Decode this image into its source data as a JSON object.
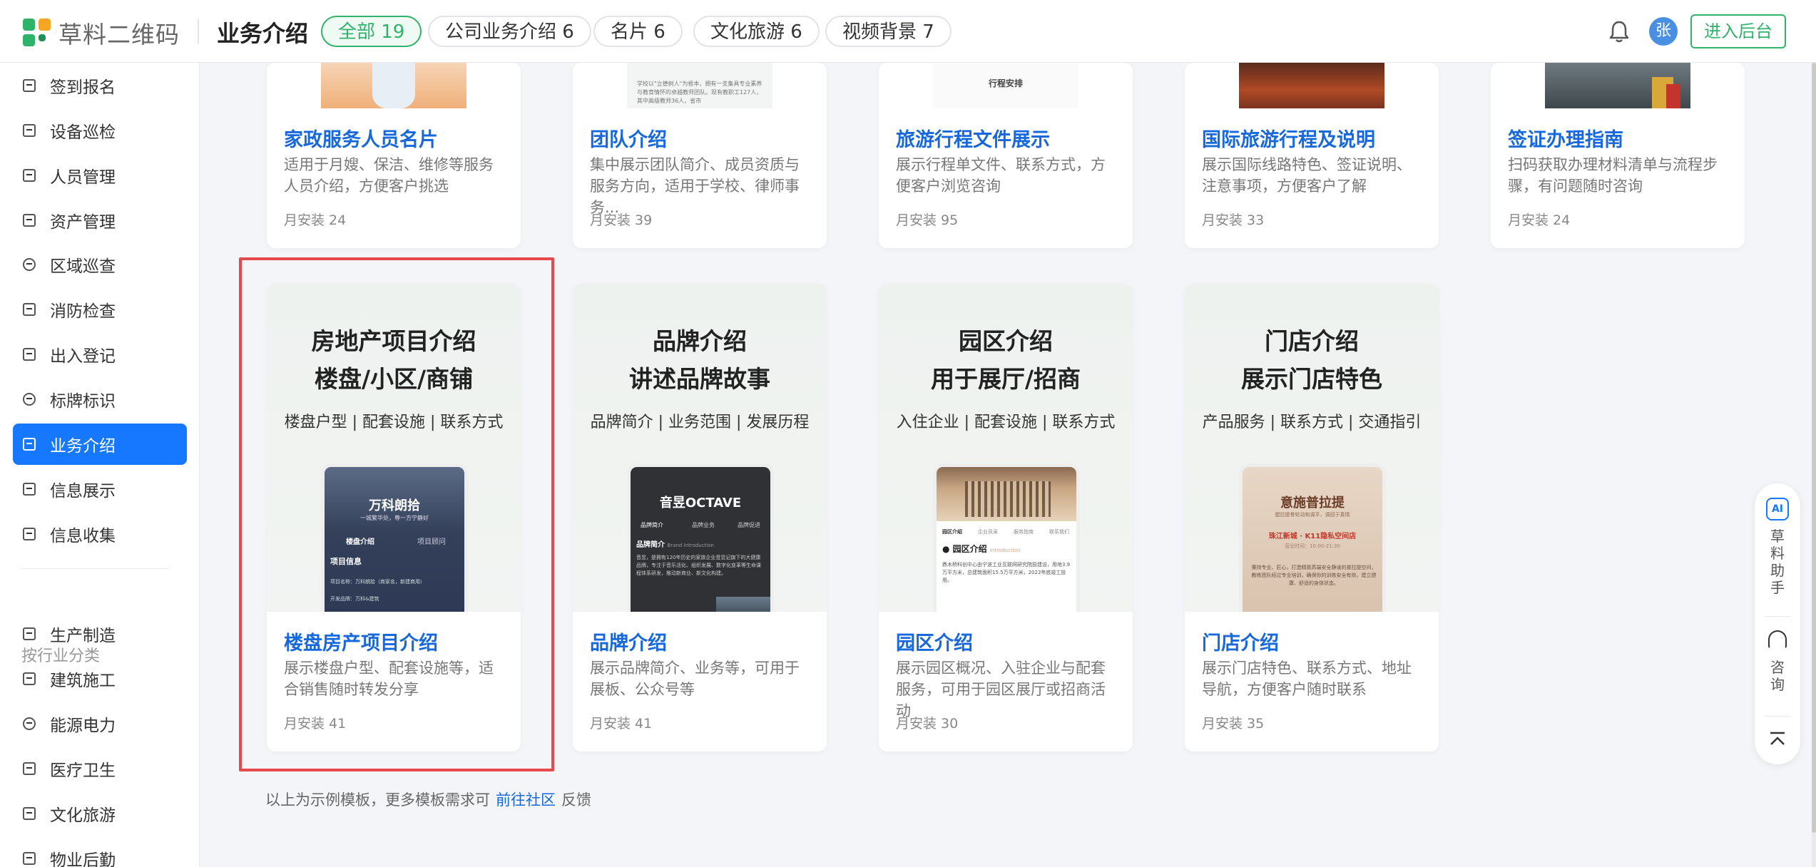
{
  "app": {
    "logo_text": "草料二维码",
    "page_title": "业务介绍"
  },
  "tabs": [
    {
      "label": "全部 19",
      "active": true
    },
    {
      "label": "公司业务介绍 6"
    },
    {
      "label": "名片 6"
    },
    {
      "label": "文化旅游 6"
    },
    {
      "label": "视频背景 7"
    }
  ],
  "header": {
    "avatar_text": "张",
    "enter_label": "进入后台"
  },
  "sidebar": {
    "items": [
      {
        "label": "签到报名",
        "icon": "checkin-icon"
      },
      {
        "label": "设备巡检",
        "icon": "device-icon"
      },
      {
        "label": "人员管理",
        "icon": "person-icon"
      },
      {
        "label": "资产管理",
        "icon": "asset-icon"
      },
      {
        "label": "区域巡查",
        "icon": "location-icon"
      },
      {
        "label": "消防检查",
        "icon": "fire-extinguisher-icon"
      },
      {
        "label": "出入登记",
        "icon": "register-icon"
      },
      {
        "label": "标牌标识",
        "icon": "tag-icon"
      },
      {
        "label": "业务介绍",
        "icon": "briefcase-icon",
        "active": true
      },
      {
        "label": "信息展示",
        "icon": "display-icon"
      },
      {
        "label": "信息收集",
        "icon": "collect-icon"
      }
    ],
    "group_title": "按行业分类",
    "industry_items": [
      {
        "label": "生产制造",
        "icon": "factory-icon"
      },
      {
        "label": "建筑施工",
        "icon": "building-icon"
      },
      {
        "label": "能源电力",
        "icon": "energy-icon"
      },
      {
        "label": "医疗卫生",
        "icon": "medical-icon"
      },
      {
        "label": "文化旅游",
        "icon": "tourism-icon"
      },
      {
        "label": "物业后勤",
        "icon": "property-icon"
      }
    ]
  },
  "top_cards": [
    {
      "title": "家政服务人员名片",
      "desc": "适用于月嫂、保洁、维修等服务人员介绍，方便客户挑选",
      "installs": "月安装  24"
    },
    {
      "title": "团队介绍",
      "desc": "集中展示团队简介、成员资质与服务方向，适用于学校、律师事务...",
      "installs": "月安装  39"
    },
    {
      "title": "旅游行程文件展示",
      "desc": "展示行程单文件、联系方式，方便客户浏览咨询",
      "installs": "月安装  95"
    },
    {
      "title": "国际旅游行程及说明",
      "desc": "展示国际线路特色、签证说明、注意事项，方便客户了解",
      "installs": "月安装  33"
    },
    {
      "title": "签证办理指南",
      "desc": "扫码获取办理材料清单与流程步骤，有问题随时咨询",
      "installs": "月安装  24"
    }
  ],
  "top_thumb_texts": {
    "team": "学校以\"立德树人\"为根本，拥有一支集具专业素养与教育情怀的卓越教师团队。现有教职工127人，其中高级教师36人，省市",
    "itinerary": "行程安排"
  },
  "preview_cards": [
    {
      "head1": "房地产项目介绍",
      "head2": "楼盘/小区/商铺",
      "sub": "楼盘户型 | 配套设施 | 联系方式",
      "phone_title": "万科朗拾",
      "phone_tagline": "一城繁华处，尊一方宁静好",
      "phone_tabs": [
        "楼盘介绍",
        "项目顾问"
      ],
      "phone_section": "项目信息",
      "phone_rows": [
        "项目名称：万科朗拾（商家名，新建商用）",
        "开发品牌：万科&建筑"
      ],
      "title": "楼盘房产项目介绍",
      "desc": "展示楼盘户型、配套设施等，适合销售随时转发分享",
      "installs": "月安装  41"
    },
    {
      "head1": "品牌介绍",
      "head2": "讲述品牌故事",
      "sub": "品牌简介 | 业务范围 | 发展历程",
      "phone_title": "音昱OCTAVE",
      "phone_tabs": [
        "品牌简介",
        "品牌业务",
        "品牌促进"
      ],
      "phone_section": "品牌简介",
      "phone_section_en": "Brand Introduction",
      "phone_body": "音昱，是拥有120年历史的家族企业音昱记旗下的大健康品牌，专注于音乐活化、组织发展、数字化变革等生命课程体系研发，推动新商业、新文化构建。",
      "title": "品牌介绍",
      "desc": "展示品牌简介、业务等，可用于展板、公众号等",
      "installs": "月安装  41"
    },
    {
      "head1": "园区介绍",
      "head2": "用于展厅/招商",
      "sub": "入住企业 | 配套设施 | 联系方式",
      "phone_tabs": [
        "园区介绍",
        "企业风采",
        "服务指南",
        "联系我们"
      ],
      "phone_section": "园区介绍",
      "phone_section_en": "Introduction",
      "phone_body": "鼎木桥科创中心由宁波工业互联网研究院投建设，用地3.9万平方米，总建筑面积15.5万平方米，2022年底竣工投用。",
      "title": "园区介绍",
      "desc": "展示园区概况、入驻企业与配套服务，可用于园区展厅或招商活动",
      "installs": "月安装  30"
    },
    {
      "head1": "门店介绍",
      "head2": "展示门店特色",
      "sub": "产品服务 | 联系方式 | 交通指引",
      "phone_title": "意施普拉提",
      "phone_tagline": "塑拉提骨轮动和调平，调回于真情",
      "phone_store": "珠江新城 · K11隐私空间店",
      "phone_hours": "营业时间：10:00-21:30",
      "phone_body": "秉持专业、匠心，打造精致高端安全静谧的普拉提空间，教练团队经过专业培训，确保你的训练安全有效，建立健康、舒适的身体状态。",
      "title": "门店介绍",
      "desc": "展示门店特色、联系方式、地址导航，方便客户随时联系",
      "installs": "月安装  35"
    }
  ],
  "footer": {
    "prefix": "以上为示例模板，更多模板需求可",
    "link": "前往社区",
    "suffix": "反馈"
  },
  "float": {
    "assistant": "草料助手",
    "consult": "咨询"
  },
  "colors": {
    "brand_green": "#2fb36b",
    "accent_blue": "#1677ff",
    "title_blue": "#1668dc",
    "highlight_red": "#e5484d"
  }
}
